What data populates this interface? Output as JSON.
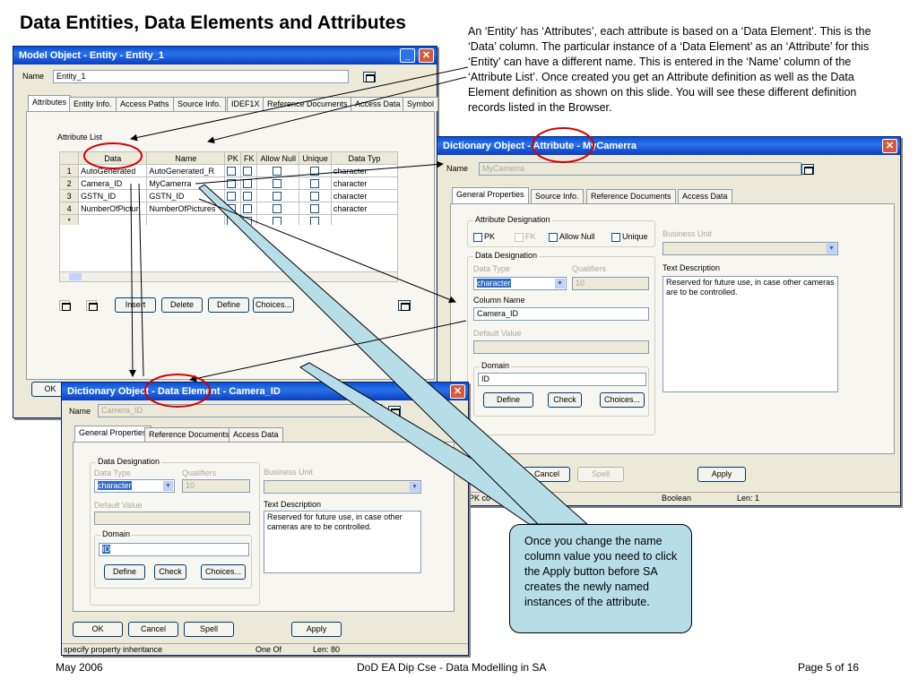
{
  "slide": {
    "title": "Data Entities, Data Elements and Attributes",
    "description": "An ‘Entity’ has ‘Attributes’, each attribute is based on a ‘Data Element’. This is the ‘Data’ column. The particular instance of a ‘Data Element’ as an ‘Attribute’ for this ‘Entity’ can have a different name. This is entered in the ‘Name’ column of the ‘Attribute List’. Once created you get an Attribute definition as well as the Data Element definition as shown on this slide. You will see these different definition records listed in the Browser.",
    "callout": "Once you change the name column value you need to click the Apply button before SA creates the newly named instances of the attribute.",
    "footer": {
      "left": "May 2006",
      "center": "DoD EA Dip Cse - Data Modelling in SA",
      "right": "Page 5 of 16"
    }
  },
  "colors": {
    "titlebar": "#0a52d6",
    "dialog_bg": "#ece9d8",
    "callout_bg": "#b7dde8",
    "highlight_circle": "#d40000",
    "selection": "#316ac5"
  },
  "entity_window": {
    "title": "Model Object - Entity - Entity_1",
    "close_icon": "close-icon",
    "name_label": "Name",
    "name_value": "Entity_1",
    "tabs": [
      "Attributes",
      "Entity Info.",
      "Access Paths",
      "Source Info.",
      "IDEF1X",
      "Reference Documents",
      "Access Data",
      "Symbol"
    ],
    "attribute_list_label": "Attribute List",
    "columns": [
      "Data",
      "Name",
      "PK",
      "FK",
      "Allow Null",
      "Unique",
      "Data Typ"
    ],
    "rows": [
      {
        "num": "1",
        "data": "AutoGenerated",
        "name": "AutoGenerated_R",
        "type": "character"
      },
      {
        "num": "2",
        "data": "Camera_ID",
        "name": "MyCamerra",
        "type": "character"
      },
      {
        "num": "3",
        "data": "GSTN_ID",
        "name": "GSTN_ID",
        "type": "character"
      },
      {
        "num": "4",
        "data": "NumberOfPictur",
        "name": "NumberOfPictures",
        "type": "character"
      },
      {
        "num": "*",
        "data": "",
        "name": "",
        "type": ""
      }
    ],
    "buttons": {
      "insert": "Insert",
      "delete": "Delete",
      "define": "Define",
      "choices": "Choices...",
      "ok": "OK"
    }
  },
  "attribute_window": {
    "title": "Dictionary Object - Attribute - MyCamerra",
    "name_label": "Name",
    "name_value": "MyCamerra",
    "tabs": [
      "General Properties",
      "Source Info.",
      "Reference Documents",
      "Access Data"
    ],
    "attribute_designation": "Attribute Designation",
    "checks": [
      "PK",
      "FK",
      "Allow Null",
      "Unique"
    ],
    "data_designation": "Data Designation",
    "data_type_label": "Data Type",
    "data_type_value": "character",
    "qualifiers_label": "Qualifiers",
    "qualifiers_value": "10",
    "column_name_label": "Column Name",
    "column_name_value": "Camera_ID",
    "default_value_label": "Default Value",
    "domain_label": "Domain",
    "domain_value": "ID",
    "business_unit_label": "Business Unit",
    "text_description_label": "Text Description",
    "text_description_value": "Reserved for future use, in case other cameras are to be controlled.",
    "buttons": {
      "define": "Define",
      "check": "Check",
      "choices": "Choices...",
      "cancel": "Cancel",
      "spell": "Spell",
      "apply": "Apply"
    },
    "status": {
      "left": "n a PK co",
      "middle": "Boolean",
      "right": "Len: 1"
    }
  },
  "element_window": {
    "title": "Dictionary Object - Data Element - Camera_ID",
    "name_label": "Name",
    "name_value": "Camera_ID",
    "tabs": [
      "General Properties",
      "Reference Documents",
      "Access Data"
    ],
    "data_designation": "Data Designation",
    "data_type_label": "Data Type",
    "data_type_value": "character",
    "qualifiers_label": "Qualifiers",
    "qualifiers_value": "10",
    "default_value_label": "Default Value",
    "domain_label": "Domain",
    "domain_value": "ID",
    "business_unit_label": "Business Unit",
    "text_description_label": "Text Description",
    "text_description_value": "Reserved for future use, in case other cameras are to be controlled.",
    "buttons": {
      "define": "Define",
      "check": "Check",
      "choices": "Choices...",
      "ok": "OK",
      "cancel": "Cancel",
      "spell": "Spell",
      "apply": "Apply"
    },
    "status": {
      "left": "specify property inheritance",
      "middle": "One Of",
      "right": "Len: 80"
    }
  }
}
